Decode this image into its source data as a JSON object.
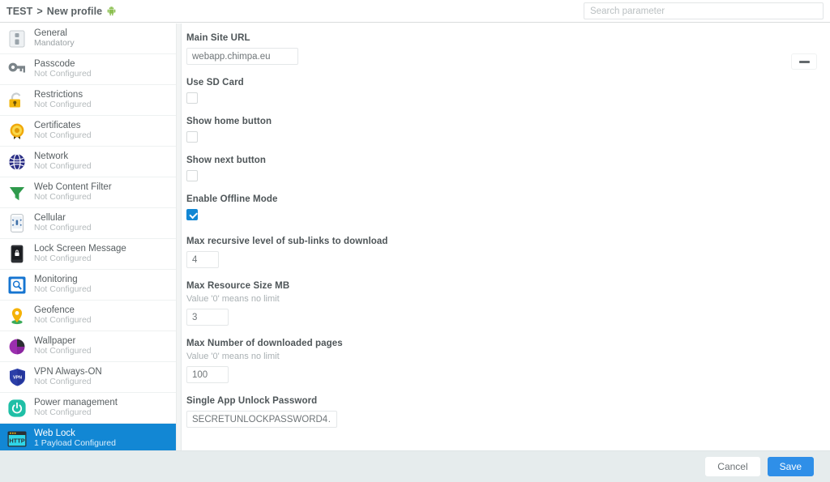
{
  "header": {
    "breadcrumb_root": "TEST",
    "breadcrumb_sep": ">",
    "breadcrumb_current": "New profile",
    "platform_icon": "android-icon",
    "platform_color": "#8cc051"
  },
  "search": {
    "placeholder": "Search parameter",
    "value": ""
  },
  "sidebar": {
    "items": [
      {
        "label": "General",
        "status": "Mandatory",
        "icon": "device-general-icon",
        "selected": false,
        "mandatory": true
      },
      {
        "label": "Passcode",
        "status": "Not Configured",
        "icon": "key-icon",
        "selected": false,
        "mandatory": false
      },
      {
        "label": "Restrictions",
        "status": "Not Configured",
        "icon": "padlock-icon",
        "selected": false,
        "mandatory": false
      },
      {
        "label": "Certificates",
        "status": "Not Configured",
        "icon": "certificate-seal-icon",
        "selected": false,
        "mandatory": false
      },
      {
        "label": "Network",
        "status": "Not Configured",
        "icon": "globe-network-icon",
        "selected": false,
        "mandatory": false
      },
      {
        "label": "Web Content Filter",
        "status": "Not Configured",
        "icon": "funnel-filter-icon",
        "selected": false,
        "mandatory": false
      },
      {
        "label": "Cellular",
        "status": "Not Configured",
        "icon": "cellular-phone-icon",
        "selected": false,
        "mandatory": false
      },
      {
        "label": "Lock Screen Message",
        "status": "Not Configured",
        "icon": "phone-lock-icon",
        "selected": false,
        "mandatory": false
      },
      {
        "label": "Monitoring",
        "status": "Not Configured",
        "icon": "monitor-search-icon",
        "selected": false,
        "mandatory": false
      },
      {
        "label": "Geofence",
        "status": "Not Configured",
        "icon": "map-pin-icon",
        "selected": false,
        "mandatory": false
      },
      {
        "label": "Wallpaper",
        "status": "Not Configured",
        "icon": "wallpaper-icon",
        "selected": false,
        "mandatory": false
      },
      {
        "label": "VPN Always-ON",
        "status": "Not Configured",
        "icon": "vpn-shield-icon",
        "selected": false,
        "mandatory": false
      },
      {
        "label": "Power management",
        "status": "Not Configured",
        "icon": "power-button-icon",
        "selected": false,
        "mandatory": false
      },
      {
        "label": "Web Lock",
        "status": "1 Payload Configured",
        "icon": "http-browser-icon",
        "selected": true,
        "mandatory": false
      }
    ]
  },
  "content": {
    "collapse_icon": "minus-icon",
    "fields": {
      "main_site_url": {
        "label": "Main Site URL",
        "value": "webapp.chimpa.eu"
      },
      "use_sd_card": {
        "label": "Use SD Card",
        "checked": false
      },
      "show_home": {
        "label": "Show home button",
        "checked": false
      },
      "show_next": {
        "label": "Show next button",
        "checked": false
      },
      "offline_mode": {
        "label": "Enable Offline Mode",
        "checked": true
      },
      "max_recursive": {
        "label": "Max recursive level of sub-links to download",
        "value": "4"
      },
      "max_resource": {
        "label": "Max Resource Size MB",
        "hint": "Value '0' means no limit",
        "value": "3"
      },
      "max_pages": {
        "label": "Max Number of downloaded pages",
        "hint": "Value '0' means no limit",
        "value": "100"
      },
      "unlock_password": {
        "label": "Single App Unlock Password",
        "value": "SECRETUNLOCKPASSWORD4…"
      }
    }
  },
  "footer": {
    "cancel_label": "Cancel",
    "save_label": "Save",
    "save_color": "#2f8fe8"
  }
}
